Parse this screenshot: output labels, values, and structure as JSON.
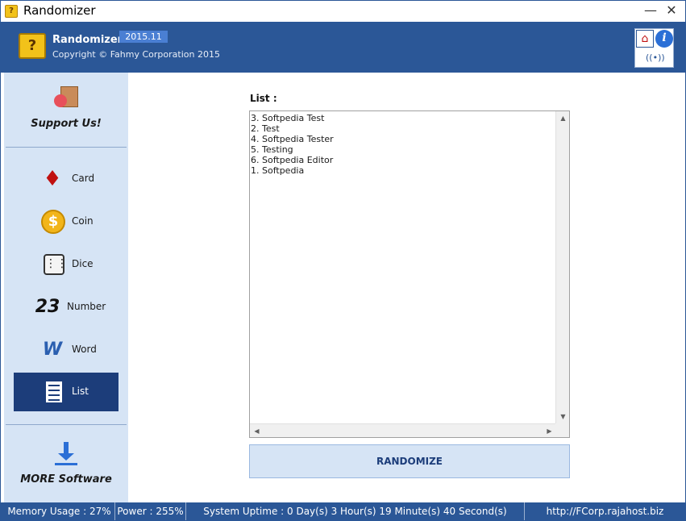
{
  "window": {
    "title": "Randomizer",
    "minimize_icon": "minimize-icon",
    "close_icon": "close-icon"
  },
  "header": {
    "app_name": "Randomizer",
    "version": "2015.11",
    "copyright": "Copyright © Fahmy Corporation 2015",
    "home_icon": "home-icon",
    "info_icon": "info-icon",
    "radio_icon": "broadcast-icon"
  },
  "sidebar": {
    "support_label": "Support Us!",
    "items": [
      {
        "label": "Card",
        "icon": "cards-icon"
      },
      {
        "label": "Coin",
        "icon": "coin-icon"
      },
      {
        "label": "Dice",
        "icon": "dice-icon"
      },
      {
        "label": "Number",
        "icon": "number-icon",
        "glyph": "23"
      },
      {
        "label": "Word",
        "icon": "word-icon"
      },
      {
        "label": "List",
        "icon": "list-icon",
        "active": true
      }
    ],
    "more_label": "MORE Software"
  },
  "main": {
    "list_label": "List :",
    "list_text": "3. Softpedia Test\n2. Test\n4. Softpedia Tester\n5. Testing\n6. Softpedia Editor\n1. Softpedia",
    "randomize_label": "RANDOMIZE"
  },
  "status": {
    "memory": "Memory Usage : 27%",
    "power": "Power : 255%",
    "uptime": "System Uptime : 0 Day(s) 3 Hour(s) 19 Minute(s) 40 Second(s)",
    "url": "http://FCorp.rajahost.biz"
  },
  "colors": {
    "accent": "#2b5797",
    "sidebar_bg": "#d6e4f5",
    "active_item": "#1c3d7a"
  }
}
